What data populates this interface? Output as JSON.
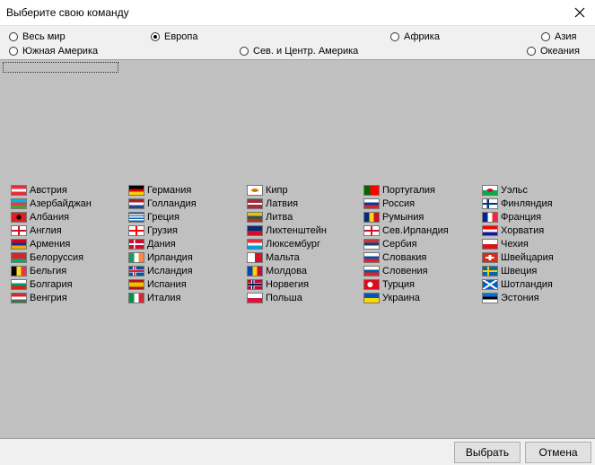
{
  "window": {
    "title": "Выберите свою команду"
  },
  "regions": [
    {
      "label": "Весь мир",
      "checked": false
    },
    {
      "label": "Европа",
      "checked": true
    },
    {
      "label": "Африка",
      "checked": false
    },
    {
      "label": "Азия",
      "checked": false
    },
    {
      "label": "Южная Америка",
      "checked": false
    },
    {
      "label": "Сев. и Центр. Америка",
      "checked": false
    },
    {
      "label": "Океания",
      "checked": false
    }
  ],
  "columns": [
    [
      {
        "name": "Австрия",
        "flag": "linear-gradient(#ed2939 33%, #fff 33% 66%, #ed2939 66%)"
      },
      {
        "name": "Азербайджан",
        "flag": "linear-gradient(#00b5e2 33%, #ef3340 33% 66%, #509e2f 66%)"
      },
      {
        "name": "Албания",
        "flag": "radial-gradient(circle, #000 25%, #e41e20 30%)"
      },
      {
        "name": "Англия",
        "flag": "linear-gradient(90deg, transparent 43%, #ce1124 43% 57%, transparent 57%), linear-gradient(transparent 40%, #ce1124 40% 60%, transparent 60%), #fff"
      },
      {
        "name": "Армения",
        "flag": "linear-gradient(#d90012 33%, #0033a0 33% 66%, #f2a800 66%)"
      },
      {
        "name": "Белоруссия",
        "flag": "linear-gradient(#d22730 66%, #00af66 66%)"
      },
      {
        "name": "Бельгия",
        "flag": "linear-gradient(90deg, #000 33%, #fdda24 33% 66%, #ef3340 66%)"
      },
      {
        "name": "Болгария",
        "flag": "linear-gradient(#fff 33%, #00966e 33% 66%, #d62612 66%)"
      },
      {
        "name": "Венгрия",
        "flag": "linear-gradient(#ce2939 33%, #fff 33% 66%, #477050 66%)"
      }
    ],
    [
      {
        "name": "Германия",
        "flag": "linear-gradient(#000 33%, #dd0000 33% 66%, #ffce00 66%)"
      },
      {
        "name": "Голландия",
        "flag": "linear-gradient(#ae1c28 33%, #fff 33% 66%, #21468b 66%)"
      },
      {
        "name": "Греция",
        "flag": "repeating-linear-gradient(#0d5eaf 0 1.4px, #fff 1.4px 2.8px)"
      },
      {
        "name": "Грузия",
        "flag": "linear-gradient(90deg, transparent 43%, #ff0000 43% 57%, transparent 57%), linear-gradient(transparent 40%, #ff0000 40% 60%, transparent 60%), #fff"
      },
      {
        "name": "Дания",
        "flag": "linear-gradient(90deg, transparent 30%, #fff 30% 42%, transparent 42%), linear-gradient(transparent 42%, #fff 42% 58%, transparent 58%), #c8102e"
      },
      {
        "name": "Ирландия",
        "flag": "linear-gradient(90deg, #169b62 33%, #fff 33% 66%, #ff883e 66%)"
      },
      {
        "name": "Исландия",
        "flag": "linear-gradient(90deg, transparent 30%, #dc1e35 30% 42%, transparent 42%), linear-gradient(transparent 42%, #dc1e35 42% 58%, transparent 58%), linear-gradient(90deg, transparent 24%, #fff 24% 48%, transparent 48%), linear-gradient(transparent 34%, #fff 34% 66%, transparent 66%), #02529c"
      },
      {
        "name": "Испания",
        "flag": "linear-gradient(#aa151b 25%, #f1bf00 25% 75%, #aa151b 75%)"
      },
      {
        "name": "Италия",
        "flag": "linear-gradient(90deg, #009246 33%, #fff 33% 66%, #ce2b37 66%)"
      }
    ],
    [
      {
        "name": "Кипр",
        "flag": "radial-gradient(ellipse 40% 30%, #d57800 60%, #fff 65%)"
      },
      {
        "name": "Латвия",
        "flag": "linear-gradient(#9e3039 40%, #fff 40% 60%, #9e3039 60%)"
      },
      {
        "name": "Литва",
        "flag": "linear-gradient(#fdb913 33%, #006a44 33% 66%, #c1272d 66%)"
      },
      {
        "name": "Лихтенштейн",
        "flag": "linear-gradient(#002b7f 50%, #ce1126 50%)"
      },
      {
        "name": "Люксембург",
        "flag": "linear-gradient(#ed2939 33%, #fff 33% 66%, #00a1de 66%)"
      },
      {
        "name": "Мальта",
        "flag": "linear-gradient(90deg, #fff 50%, #cf142b 50%)"
      },
      {
        "name": "Молдова",
        "flag": "linear-gradient(90deg, #0046ae 33%, #ffd200 33% 66%, #cc092f 66%)"
      },
      {
        "name": "Норвегия",
        "flag": "linear-gradient(90deg, transparent 30%, #00205b 30% 42%, transparent 42%), linear-gradient(transparent 42%, #00205b 42% 58%, transparent 58%), linear-gradient(90deg, transparent 24%, #fff 24% 48%, transparent 48%), linear-gradient(transparent 34%, #fff 34% 66%, transparent 66%), #ba0c2f"
      },
      {
        "name": "Польша",
        "flag": "linear-gradient(#fff 50%, #dc143c 50%)"
      }
    ],
    [
      {
        "name": "Португалия",
        "flag": "linear-gradient(90deg, #006600 40%, #ff0000 40%)"
      },
      {
        "name": "Россия",
        "flag": "linear-gradient(#fff 33%, #0039a6 33% 66%, #d52b1e 66%)"
      },
      {
        "name": "Румыния",
        "flag": "linear-gradient(90deg, #002b7f 33%, #fcd116 33% 66%, #ce1126 66%)"
      },
      {
        "name": "Сев.Ирландия",
        "flag": "linear-gradient(90deg, transparent 43%, #ce1124 43% 57%, transparent 57%), linear-gradient(transparent 40%, #ce1124 40% 60%, transparent 60%), #fff"
      },
      {
        "name": "Сербия",
        "flag": "linear-gradient(#c6363c 33%, #0c4076 33% 66%, #fff 66%)"
      },
      {
        "name": "Словакия",
        "flag": "linear-gradient(#fff 33%, #0b4ea2 33% 66%, #ee1c25 66%)"
      },
      {
        "name": "Словения",
        "flag": "linear-gradient(#fff 33%, #005da4 33% 66%, #ed1c24 66%)"
      },
      {
        "name": "Турция",
        "flag": "radial-gradient(circle at 40% 50%, #fff 25%, #e30a17 30%)"
      },
      {
        "name": "Украина",
        "flag": "linear-gradient(#0057b7 50%, #ffd700 50%)"
      }
    ],
    [
      {
        "name": "Уэльс",
        "flag": "radial-gradient(ellipse 35% 30%, #c8102e 60%, transparent 65%), linear-gradient(#fff 50%, #00b140 50%)"
      },
      {
        "name": "Финляндия",
        "flag": "linear-gradient(90deg, transparent 28%, #003580 28% 44%, transparent 44%), linear-gradient(transparent 38%, #003580 38% 62%, transparent 62%), #fff"
      },
      {
        "name": "Франция",
        "flag": "linear-gradient(90deg, #002395 33%, #fff 33% 66%, #ed2939 66%)"
      },
      {
        "name": "Хорватия",
        "flag": "linear-gradient(#ff0000 33%, #fff 33% 66%, #171796 66%)"
      },
      {
        "name": "Чехия",
        "flag": "linear-gradient(#fff 50%, #d7141a 50%)"
      },
      {
        "name": "Швейцария",
        "flag": "linear-gradient(90deg, transparent 42%, #fff 42% 58%, transparent 58%) center/100% 60% no-repeat, linear-gradient(transparent 40%, #fff 40% 60%, transparent 60%) center/60% 100% no-repeat, #d52b1e"
      },
      {
        "name": "Швеция",
        "flag": "linear-gradient(90deg, transparent 30%, #fecc02 30% 44%, transparent 44%), linear-gradient(transparent 40%, #fecc02 40% 60%, transparent 60%), #006aa7"
      },
      {
        "name": "Шотландия",
        "flag": "linear-gradient(34deg, transparent 44%, #fff 44% 56%, transparent 56%), linear-gradient(-34deg, transparent 44%, #fff 44% 56%, transparent 56%), #005eb8"
      },
      {
        "name": "Эстония",
        "flag": "linear-gradient(#0072ce 33%, #000 33% 66%, #fff 66%)"
      }
    ]
  ],
  "buttons": {
    "select": "Выбрать",
    "cancel": "Отмена"
  }
}
